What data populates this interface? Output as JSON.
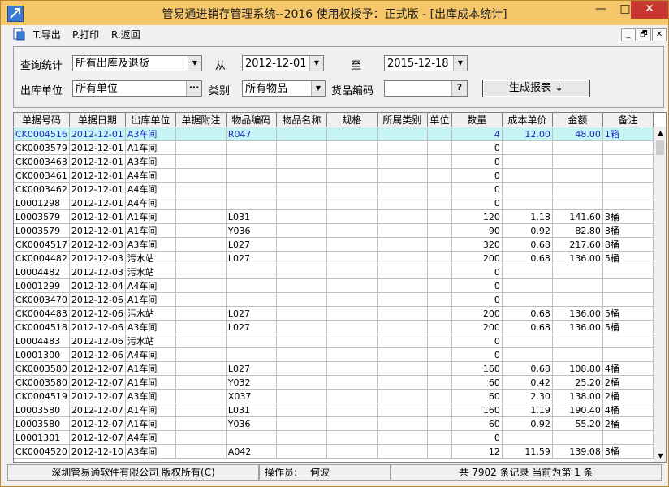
{
  "window": {
    "title": "管易通进销存管理系统--2016  使用权授予：正式版 - [出库成本统计]",
    "min_glyph": "—",
    "max_glyph": "□",
    "close_glyph": "✕"
  },
  "menu": {
    "items": [
      "T.导出",
      "P.打印",
      "R.返回"
    ],
    "mdi_controls": [
      "_",
      "🗗",
      "✕"
    ]
  },
  "filters": {
    "query_label": "查询统计",
    "query_value": "所有出库及退货",
    "from_label": "从",
    "from_date": "2012-12-01",
    "to_label": "至",
    "to_date": "2015-12-18",
    "unit_label": "出库单位",
    "unit_value": "所有单位",
    "unit_btn": "···",
    "category_label": "类别",
    "category_value": "所有物品",
    "code_label": "货品编码",
    "code_value": "",
    "code_btn": "?",
    "generate_label": "生成报表 ↓"
  },
  "grid": {
    "columns": [
      "单据号码",
      "单据日期",
      "出库单位",
      "单据附注",
      "物品编码",
      "物品名称",
      "规格",
      "所属类别",
      "单位",
      "数量",
      "成本单价",
      "金额",
      "备注"
    ],
    "rows": [
      [
        "CK0004516",
        "2012-12-01",
        "A3车间",
        "",
        "R047",
        "",
        "",
        "",
        "",
        "4",
        "12.00",
        "48.00",
        "1箱"
      ],
      [
        "CK0003579",
        "2012-12-01",
        "A1车间",
        "",
        "",
        "",
        "",
        "",
        "",
        "0",
        "",
        "",
        ""
      ],
      [
        "CK0003463",
        "2012-12-01",
        "A3车间",
        "",
        "",
        "",
        "",
        "",
        "",
        "0",
        "",
        "",
        ""
      ],
      [
        "CK0003461",
        "2012-12-01",
        "A4车间",
        "",
        "",
        "",
        "",
        "",
        "",
        "0",
        "",
        "",
        ""
      ],
      [
        "CK0003462",
        "2012-12-01",
        "A4车间",
        "",
        "",
        "",
        "",
        "",
        "",
        "0",
        "",
        "",
        ""
      ],
      [
        "L0001298",
        "2012-12-01",
        "A4车间",
        "",
        "",
        "",
        "",
        "",
        "",
        "0",
        "",
        "",
        ""
      ],
      [
        "L0003579",
        "2012-12-01",
        "A1车间",
        "",
        "L031",
        "",
        "",
        "",
        "",
        "120",
        "1.18",
        "141.60",
        "3桶"
      ],
      [
        "L0003579",
        "2012-12-01",
        "A1车间",
        "",
        "Y036",
        "",
        "",
        "",
        "",
        "90",
        "0.92",
        "82.80",
        "3桶"
      ],
      [
        "CK0004517",
        "2012-12-03",
        "A3车间",
        "",
        "L027",
        "",
        "",
        "",
        "",
        "320",
        "0.68",
        "217.60",
        "8桶"
      ],
      [
        "CK0004482",
        "2012-12-03",
        "污水站",
        "",
        "L027",
        "",
        "",
        "",
        "",
        "200",
        "0.68",
        "136.00",
        "5桶"
      ],
      [
        "L0004482",
        "2012-12-03",
        "污水站",
        "",
        "",
        "",
        "",
        "",
        "",
        "0",
        "",
        "",
        ""
      ],
      [
        "L0001299",
        "2012-12-04",
        "A4车间",
        "",
        "",
        "",
        "",
        "",
        "",
        "0",
        "",
        "",
        ""
      ],
      [
        "CK0003470",
        "2012-12-06",
        "A1车间",
        "",
        "",
        "",
        "",
        "",
        "",
        "0",
        "",
        "",
        ""
      ],
      [
        "CK0004483",
        "2012-12-06",
        "污水站",
        "",
        "L027",
        "",
        "",
        "",
        "",
        "200",
        "0.68",
        "136.00",
        "5桶"
      ],
      [
        "CK0004518",
        "2012-12-06",
        "A3车间",
        "",
        "L027",
        "",
        "",
        "",
        "",
        "200",
        "0.68",
        "136.00",
        "5桶"
      ],
      [
        "L0004483",
        "2012-12-06",
        "污水站",
        "",
        "",
        "",
        "",
        "",
        "",
        "0",
        "",
        "",
        ""
      ],
      [
        "L0001300",
        "2012-12-06",
        "A4车间",
        "",
        "",
        "",
        "",
        "",
        "",
        "0",
        "",
        "",
        ""
      ],
      [
        "CK0003580",
        "2012-12-07",
        "A1车间",
        "",
        "L027",
        "",
        "",
        "",
        "",
        "160",
        "0.68",
        "108.80",
        "4桶"
      ],
      [
        "CK0003580",
        "2012-12-07",
        "A1车间",
        "",
        "Y032",
        "",
        "",
        "",
        "",
        "60",
        "0.42",
        "25.20",
        "2桶"
      ],
      [
        "CK0004519",
        "2012-12-07",
        "A3车间",
        "",
        "X037",
        "",
        "",
        "",
        "",
        "60",
        "2.30",
        "138.00",
        "2桶"
      ],
      [
        "L0003580",
        "2012-12-07",
        "A1车间",
        "",
        "L031",
        "",
        "",
        "",
        "",
        "160",
        "1.19",
        "190.40",
        "4桶"
      ],
      [
        "L0003580",
        "2012-12-07",
        "A1车间",
        "",
        "Y036",
        "",
        "",
        "",
        "",
        "60",
        "0.92",
        "55.20",
        "2桶"
      ],
      [
        "L0001301",
        "2012-12-07",
        "A4车间",
        "",
        "",
        "",
        "",
        "",
        "",
        "0",
        "",
        "",
        ""
      ],
      [
        "CK0004520",
        "2012-12-10",
        "A3车间",
        "",
        "A042",
        "",
        "",
        "",
        "",
        "12",
        "11.59",
        "139.08",
        "3桶"
      ]
    ]
  },
  "status": {
    "company": "深圳管易通软件有限公司 版权所有(C)",
    "operator_label": "操作员:",
    "operator_name": "何波",
    "record_info": "共 7902 条记录 当前为第 1 条"
  },
  "colors": {
    "titlebar": "#f5c76a",
    "selected_row": "#c6f3f3",
    "selected_text": "#1d2fc6",
    "close_button": "#c7372f"
  }
}
